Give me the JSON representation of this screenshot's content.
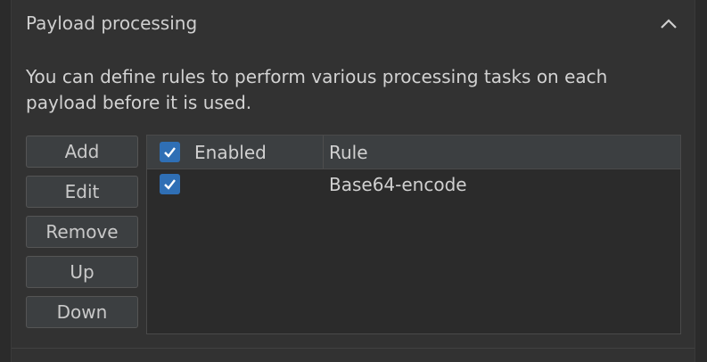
{
  "section": {
    "title": "Payload processing",
    "description": "You can define rules to perform various processing tasks on each payload before it is used."
  },
  "buttons": {
    "add": "Add",
    "edit": "Edit",
    "remove": "Remove",
    "up": "Up",
    "down": "Down"
  },
  "table": {
    "columns": {
      "enabled": "Enabled",
      "rule": "Rule"
    },
    "rows": [
      {
        "enabled": true,
        "rule": "Base64-encode"
      }
    ]
  },
  "colors": {
    "checkbox": "#2f6fb5",
    "background": "#323232"
  }
}
